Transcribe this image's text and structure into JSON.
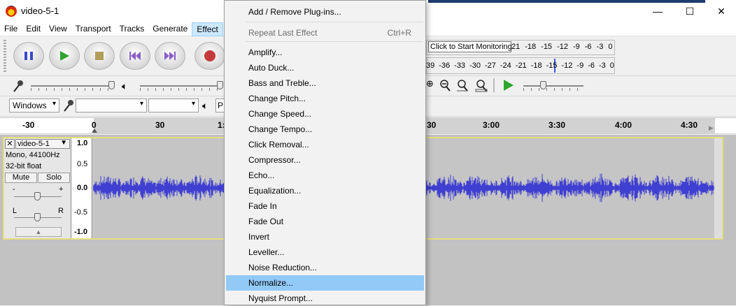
{
  "window": {
    "title": "video-5-1",
    "minimize": "—",
    "maximize": "☐",
    "close": "✕"
  },
  "menubar": [
    "File",
    "Edit",
    "View",
    "Transport",
    "Tracks",
    "Generate",
    "Effect"
  ],
  "meters": {
    "record_hint": "Click to Start Monitoring",
    "record_ticks": [
      "21",
      "-18",
      "-15",
      "-12",
      "-9",
      "-6",
      "-3",
      "0"
    ],
    "play_ticks": [
      "39",
      "-36",
      "-33",
      "-30",
      "-27",
      "-24",
      "-21",
      "-18",
      "-15",
      "-12",
      "-9",
      "-6",
      "-3",
      "0"
    ]
  },
  "device": {
    "host": "Windows",
    "play_partial": "P"
  },
  "ruler": [
    "-30",
    "0",
    "30",
    "1:",
    "30",
    "3:00",
    "3:30",
    "4:00",
    "4:30"
  ],
  "track": {
    "name": "video-5-1",
    "info1": "Mono, 44100Hz",
    "info2": "32-bit float",
    "mute": "Mute",
    "solo": "Solo",
    "gain_minus": "-",
    "gain_plus": "+",
    "pan_l": "L",
    "pan_r": "R",
    "vruler": [
      "1.0",
      "0.5",
      "0.0",
      "-0.5",
      "-1.0"
    ]
  },
  "effect_menu": [
    {
      "label": "Add / Remove Plug-ins...",
      "disabled": false
    },
    {
      "label": "Repeat Last Effect",
      "shortcut": "Ctrl+R",
      "disabled": true
    },
    {
      "label": "Amplify..."
    },
    {
      "label": "Auto Duck..."
    },
    {
      "label": "Bass and Treble..."
    },
    {
      "label": "Change Pitch..."
    },
    {
      "label": "Change Speed..."
    },
    {
      "label": "Change Tempo..."
    },
    {
      "label": "Click Removal..."
    },
    {
      "label": "Compressor..."
    },
    {
      "label": "Echo..."
    },
    {
      "label": "Equalization..."
    },
    {
      "label": "Fade In"
    },
    {
      "label": "Fade Out"
    },
    {
      "label": "Invert"
    },
    {
      "label": "Leveller..."
    },
    {
      "label": "Noise Reduction..."
    },
    {
      "label": "Normalize...",
      "highlighted": true
    },
    {
      "label": "Nyquist Prompt..."
    }
  ]
}
